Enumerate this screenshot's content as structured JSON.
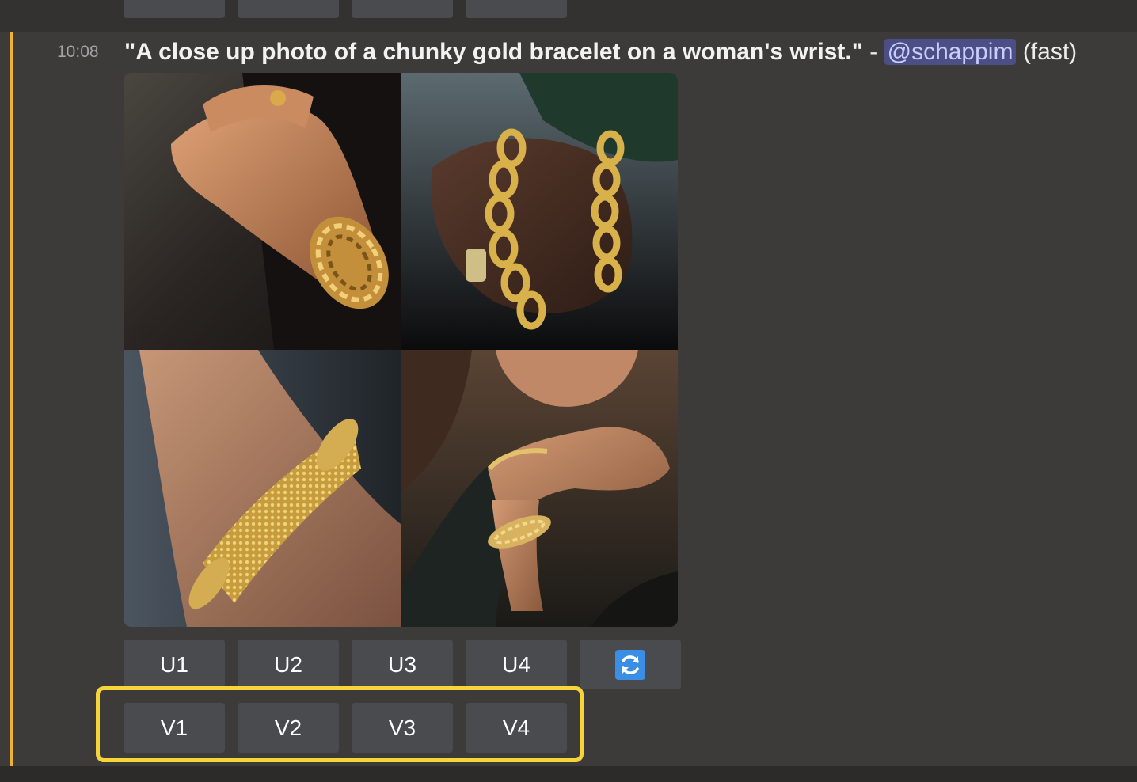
{
  "colors": {
    "accent_bar": "#f0b132",
    "highlight": "#f7d539",
    "button_bg": "#4a4b4f",
    "mention_bg": "#4c4f85",
    "refresh": "#3a8ee6"
  },
  "message": {
    "timestamp": "10:08",
    "prompt": "\"A close up photo of a chunky gold bracelet on a woman's wrist.\"",
    "separator": " - ",
    "mention": "@schappim",
    "mode": "(fast)"
  },
  "images": [
    {
      "icon": "gold-woven-bracelet-clasped-hands"
    },
    {
      "icon": "gold-chain-bracelet-green-sweater"
    },
    {
      "icon": "gold-mesh-bracelet-wrist"
    },
    {
      "icon": "gold-bracelets-crossed-arms"
    }
  ],
  "upscale_buttons": [
    "U1",
    "U2",
    "U3",
    "U4"
  ],
  "variation_buttons": [
    "V1",
    "V2",
    "V3",
    "V4"
  ],
  "refresh_icon": "refresh-icon"
}
